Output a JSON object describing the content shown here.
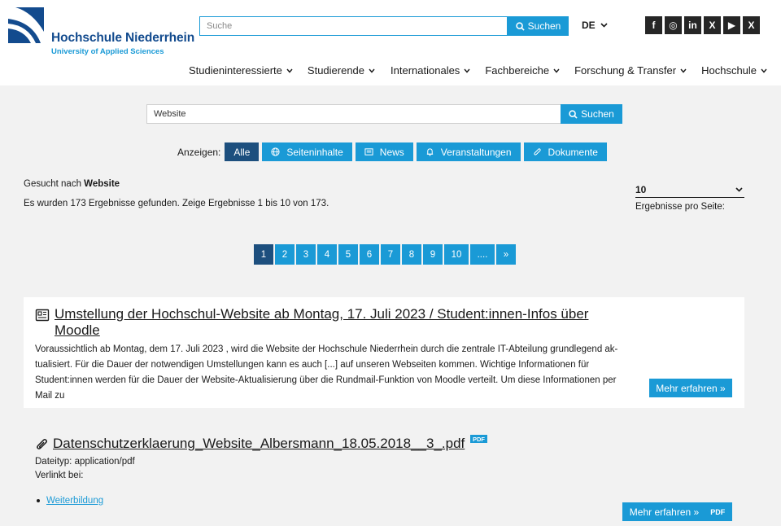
{
  "header": {
    "logo_name": "Hochschule Niederrhein",
    "logo_sub": "University of Applied Sciences",
    "search_placeholder": "Suche",
    "search_button": "Suchen",
    "language": "DE",
    "social": [
      "f",
      "◎",
      "in",
      "X",
      "▶",
      "X"
    ],
    "social_names": [
      "facebook-icon",
      "instagram-icon",
      "linkedin-icon",
      "x-icon",
      "youtube-icon",
      "xing-icon"
    ],
    "nav": [
      "Studieninteressierte",
      "Studierende",
      "Internationales",
      "Fachbereiche",
      "Forschung & Transfer",
      "Hochschule"
    ]
  },
  "search": {
    "value": "Website",
    "button": "Suchen"
  },
  "filters": {
    "label": "Anzeigen:",
    "items": [
      "Alle",
      "Seiteninhalte",
      "News",
      "Veranstaltungen",
      "Dokumente"
    ]
  },
  "summary": {
    "searched_prefix": "Gesucht nach",
    "searched_term": "Website",
    "count_text": "Es wurden 173 Ergebnisse gefunden. Zeige Ergebnisse 1 bis 10 von 173."
  },
  "per_page": {
    "value": "10",
    "label": "Ergebnisse pro Seite:"
  },
  "pagination": [
    "1",
    "2",
    "3",
    "4",
    "5",
    "6",
    "7",
    "8",
    "9",
    "10",
    "....",
    "»"
  ],
  "results": [
    {
      "title": "Umstellung der Hochschul-Website ab Montag, 17. Juli 2023 / Student:innen-Infos über Moodle",
      "snippet": "Voraussichtlich ab Montag, dem 17. Juli 2023 , wird die Website der Hochschule Niederrhein durch die zentrale IT-Abteilung grundlegend ak-tualisiert. Für die Dauer der notwendigen Umstellungen kann es auch [...] auf unseren Webseiten kommen. Wichtige Informationen für Student:innen werden für die Dauer der Website-Aktualisierung über die Rundmail-Funktion von Moodle verteilt. Um diese Informationen per Mail zu",
      "more": "Mehr erfahren »"
    },
    {
      "title": "Datenschutzerklaerung_Website_Albersmann_18.05.2018__3_.pdf",
      "badge": "PDF",
      "filetype": "Dateityp: application/pdf",
      "linked": "Verlinkt bei:",
      "link": "Weiterbildung",
      "more": "Mehr erfahren »",
      "more_badge": "PDF"
    }
  ]
}
